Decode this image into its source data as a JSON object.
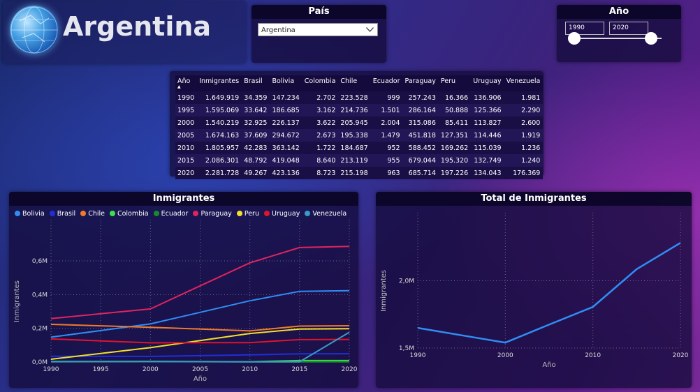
{
  "header": {
    "title": "Argentina"
  },
  "country_filter": {
    "title": "País",
    "selected": "Argentina"
  },
  "year_filter": {
    "title": "Año",
    "from": "1990",
    "to": "2020"
  },
  "table": {
    "columns": [
      "Año",
      "Inmigrantes",
      "Brasil",
      "Bolivia",
      "Colombia",
      "Chile",
      "Ecuador",
      "Paraguay",
      "Peru",
      "Uruguay",
      "Venezuela"
    ],
    "rows": [
      [
        "1990",
        "1.649.919",
        "34.359",
        "147.234",
        "2.702",
        "223.528",
        "999",
        "257.243",
        "16.366",
        "136.906",
        "1.981"
      ],
      [
        "1995",
        "1.595.069",
        "33.642",
        "186.685",
        "3.162",
        "214.736",
        "1.501",
        "286.164",
        "50.888",
        "125.366",
        "2.290"
      ],
      [
        "2000",
        "1.540.219",
        "32.925",
        "226.137",
        "3.622",
        "205.945",
        "2.004",
        "315.086",
        "85.411",
        "113.827",
        "2.600"
      ],
      [
        "2005",
        "1.674.163",
        "37.609",
        "294.672",
        "2.673",
        "195.338",
        "1.479",
        "451.818",
        "127.351",
        "114.446",
        "1.919"
      ],
      [
        "2010",
        "1.805.957",
        "42.283",
        "363.142",
        "1.722",
        "184.687",
        "952",
        "588.452",
        "169.262",
        "115.039",
        "1.236"
      ],
      [
        "2015",
        "2.086.301",
        "48.792",
        "419.048",
        "8.640",
        "213.119",
        "955",
        "679.044",
        "195.320",
        "132.749",
        "1.240"
      ],
      [
        "2020",
        "2.281.728",
        "49.267",
        "423.136",
        "8.723",
        "215.198",
        "963",
        "685.714",
        "197.226",
        "134.043",
        "176.369"
      ]
    ]
  },
  "chart_data": [
    {
      "type": "line",
      "title": "Inmigrantes",
      "xlabel": "Año",
      "ylabel": "Inmigrantes",
      "x": [
        1990,
        1995,
        2000,
        2005,
        2010,
        2015,
        2020
      ],
      "xticks": [
        "1990",
        "1995",
        "2000",
        "2005",
        "2010",
        "2015",
        "2020"
      ],
      "ylim": [
        0,
        720000
      ],
      "yticks": [
        0,
        200000,
        400000,
        600000
      ],
      "ytick_labels": [
        "0,0M",
        "0,2M",
        "0,4M",
        "0,6M"
      ],
      "grid": true,
      "legend": "top",
      "series": [
        {
          "name": "Bolivia",
          "color": "#2f8ef5",
          "values": [
            147234,
            186685,
            226137,
            294672,
            363142,
            419048,
            423136
          ]
        },
        {
          "name": "Brasil",
          "color": "#1f2fd8",
          "values": [
            34359,
            33642,
            32925,
            37609,
            42283,
            48792,
            49267
          ]
        },
        {
          "name": "Chile",
          "color": "#f07a2a",
          "values": [
            223528,
            214736,
            205945,
            195338,
            184687,
            213119,
            215198
          ]
        },
        {
          "name": "Colombia",
          "color": "#3ce04a",
          "values": [
            2702,
            3162,
            3622,
            2673,
            1722,
            8640,
            8723
          ]
        },
        {
          "name": "Ecuador",
          "color": "#178a2a",
          "values": [
            999,
            1501,
            2004,
            1479,
            952,
            955,
            963
          ]
        },
        {
          "name": "Paraguay",
          "color": "#e0245e",
          "values": [
            257243,
            286164,
            315086,
            451818,
            588452,
            679044,
            685714
          ]
        },
        {
          "name": "Peru",
          "color": "#f2e02a",
          "values": [
            16366,
            50888,
            85411,
            127351,
            169262,
            195320,
            197226
          ]
        },
        {
          "name": "Uruguay",
          "color": "#e0142a",
          "values": [
            136906,
            125366,
            113827,
            114446,
            115039,
            132749,
            134043
          ]
        },
        {
          "name": "Venezuela",
          "color": "#3a9ac8",
          "values": [
            1981,
            2290,
            2600,
            1919,
            1236,
            1240,
            176369
          ]
        }
      ]
    },
    {
      "type": "line",
      "title": "Total de Inmigrantes",
      "xlabel": "Año",
      "ylabel": "Inmigrantes",
      "x": [
        1990,
        1995,
        2000,
        2005,
        2010,
        2015,
        2020
      ],
      "xticks": [
        "1990",
        "2000",
        "2010",
        "2020"
      ],
      "ylim": [
        1500000,
        2350000
      ],
      "yticks": [
        1500000,
        2000000
      ],
      "ytick_labels": [
        "1,5M",
        "2,0M"
      ],
      "grid": true,
      "series": [
        {
          "color": "#2f8ef5",
          "values": [
            1649919,
            1595069,
            1540219,
            1674163,
            1805957,
            2086301,
            2281728
          ]
        }
      ]
    }
  ]
}
